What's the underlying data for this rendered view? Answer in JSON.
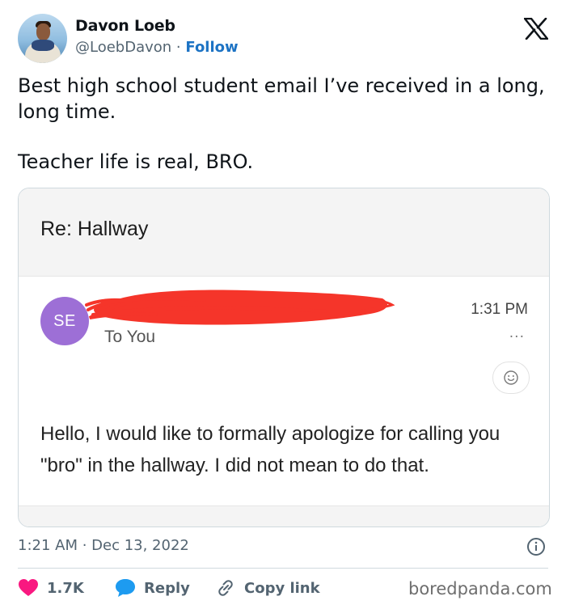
{
  "author": {
    "name": "Davon Loeb",
    "handle": "@LoebDavon",
    "separator": " · ",
    "follow_label": "Follow"
  },
  "tweet": {
    "lines": [
      "Best high school student email I’ve received in a long, long time.",
      "Teacher life is real, BRO."
    ]
  },
  "email": {
    "subject": "Re: Hallway",
    "sender_initials": "SE",
    "recipient": "To You",
    "time": "1:31 PM",
    "more_label": "···",
    "body": "Hello, I would like to formally apologize for calling you \"bro\" in the hallway. I did not mean to do that."
  },
  "meta": {
    "timestamp": "1:21 AM · Dec 13, 2022"
  },
  "actions": {
    "likes_count": "1.7K",
    "reply_label": "Reply",
    "copy_link_label": "Copy link"
  },
  "watermark": "boredpanda.com",
  "colors": {
    "like": "#f91880",
    "reply": "#1d9bf0",
    "follow": "#1d73c4",
    "sender_avatar": "#9d6fd6",
    "redaction": "#f5352a"
  },
  "icons": [
    "x-logo-icon",
    "info-icon",
    "heart-icon",
    "reply-bubble-icon",
    "link-icon",
    "emoji-icon"
  ]
}
